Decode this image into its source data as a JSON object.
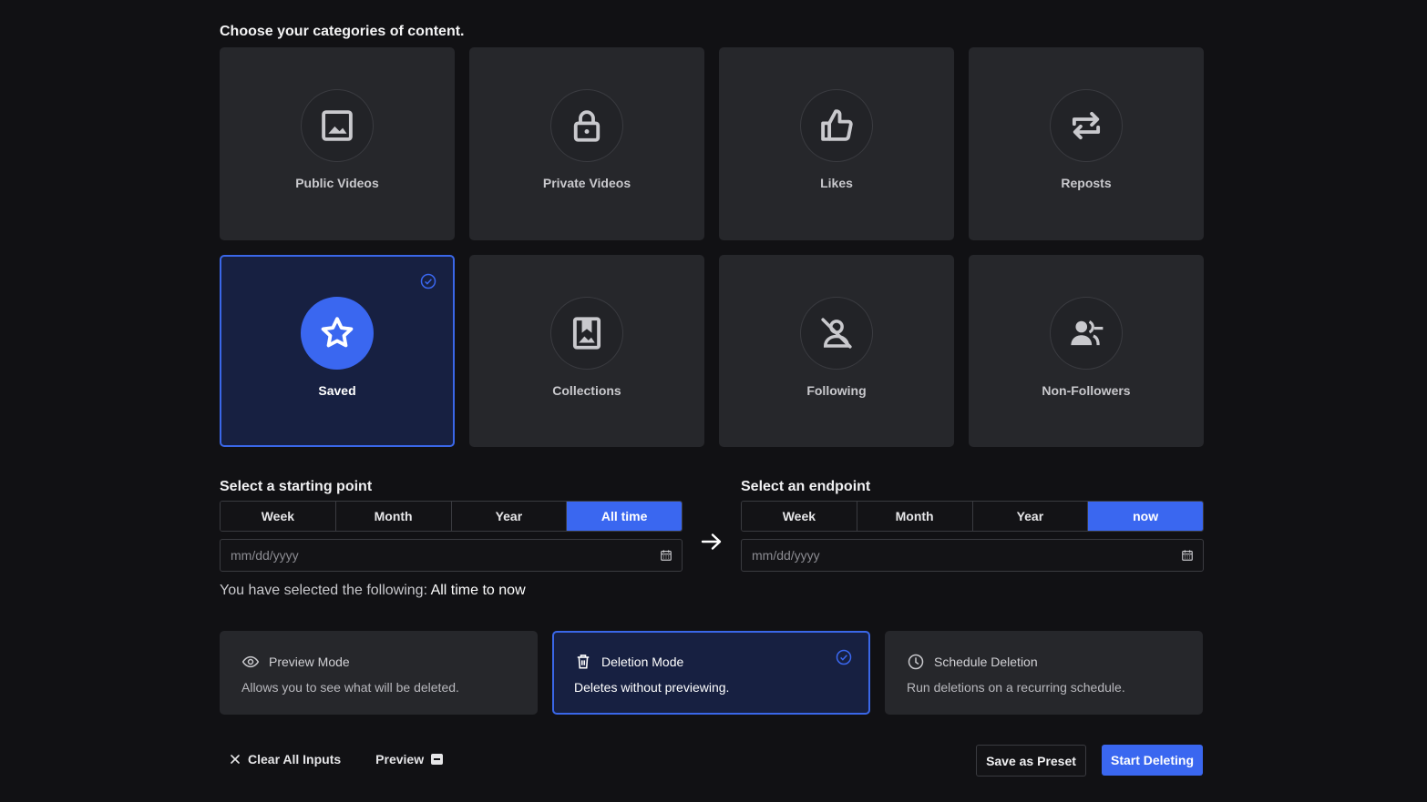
{
  "heading": "Choose your categories of content.",
  "categories": [
    {
      "label": "Public Videos",
      "icon": "image-icon",
      "selected": false
    },
    {
      "label": "Private Videos",
      "icon": "lock-icon",
      "selected": false
    },
    {
      "label": "Likes",
      "icon": "thumbs-up-icon",
      "selected": false
    },
    {
      "label": "Reposts",
      "icon": "repost-icon",
      "selected": false
    },
    {
      "label": "Saved",
      "icon": "star-icon",
      "selected": true
    },
    {
      "label": "Collections",
      "icon": "bookmark-image-icon",
      "selected": false
    },
    {
      "label": "Following",
      "icon": "user-off-icon",
      "selected": false
    },
    {
      "label": "Non-Followers",
      "icon": "users-minus-icon",
      "selected": false
    }
  ],
  "start": {
    "title": "Select a starting point",
    "options": [
      "Week",
      "Month",
      "Year",
      "All time"
    ],
    "active": "All time",
    "date_placeholder": "mm/dd/yyyy"
  },
  "end": {
    "title": "Select an endpoint",
    "options": [
      "Week",
      "Month",
      "Year",
      "now"
    ],
    "active": "now",
    "date_placeholder": "mm/dd/yyyy"
  },
  "summary": {
    "prefix": "You have selected the following:",
    "value": "All time to now"
  },
  "modes": [
    {
      "title": "Preview Mode",
      "desc": "Allows you to see what will be deleted.",
      "icon": "eye-icon",
      "selected": false
    },
    {
      "title": "Deletion Mode",
      "desc": "Deletes without previewing.",
      "icon": "trash-icon",
      "selected": true
    },
    {
      "title": "Schedule Deletion",
      "desc": "Run deletions on a recurring schedule.",
      "icon": "clock-icon",
      "selected": false
    }
  ],
  "footer": {
    "clear_label": "Clear All Inputs",
    "preview_label": "Preview",
    "preset_label": "Save as Preset",
    "start_label": "Start Deleting"
  },
  "colors": {
    "accent": "#3a67f0",
    "background": "#111114",
    "card": "#26272b",
    "selected_card": "#172041"
  }
}
